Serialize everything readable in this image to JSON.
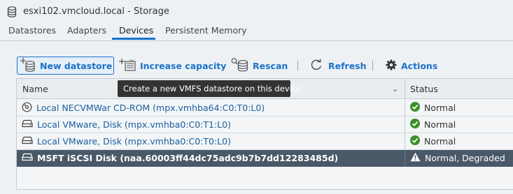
{
  "window": {
    "title": "esxi102.vmcloud.local - Storage",
    "icon": "database-icon"
  },
  "tabs": [
    {
      "label": "Datastores",
      "active": false
    },
    {
      "label": "Adapters",
      "active": false
    },
    {
      "label": "Devices",
      "active": true
    },
    {
      "label": "Persistent Memory",
      "active": false
    }
  ],
  "toolbar": {
    "new_datastore": {
      "label": "New datastore",
      "icon": "new-datastore-icon"
    },
    "increase_capacity": {
      "label": "Increase capacity",
      "icon": "increase-capacity-icon"
    },
    "rescan": {
      "label": "Rescan",
      "icon": "rescan-icon"
    },
    "refresh": {
      "label": "Refresh",
      "icon": "refresh-icon"
    },
    "actions": {
      "label": "Actions",
      "icon": "gear-icon"
    }
  },
  "tooltip": {
    "text": "Create a new VMFS datastore on this device"
  },
  "table": {
    "columns": {
      "name": "Name",
      "status": "Status"
    },
    "rows": [
      {
        "name": "Local NECVMWar CD-ROM (mpx.vmhba64:C0:T0:L0)",
        "device_icon": "cdrom-icon",
        "status": "Normal",
        "status_icon": "check-circle-icon",
        "selected": false
      },
      {
        "name": "Local VMware, Disk (mpx.vmhba0:C0:T1:L0)",
        "device_icon": "disk-icon",
        "status": "Normal",
        "status_icon": "check-circle-icon",
        "selected": false
      },
      {
        "name": "Local VMware, Disk (mpx.vmhba0:C0:T0:L0)",
        "device_icon": "disk-icon",
        "status": "Normal",
        "status_icon": "check-circle-icon",
        "selected": false
      },
      {
        "name": "MSFT iSCSI Disk (naa.60003ff44dc75adc9b7b7dd12283485d)",
        "device_icon": "disk-icon",
        "status": "Normal, Degraded",
        "status_icon": "warning-icon",
        "selected": true
      }
    ]
  },
  "colors": {
    "accent": "#1a73c9",
    "ok": "#3c8f2c",
    "selected_row": "#4a5968",
    "link": "#1a5f9e"
  }
}
